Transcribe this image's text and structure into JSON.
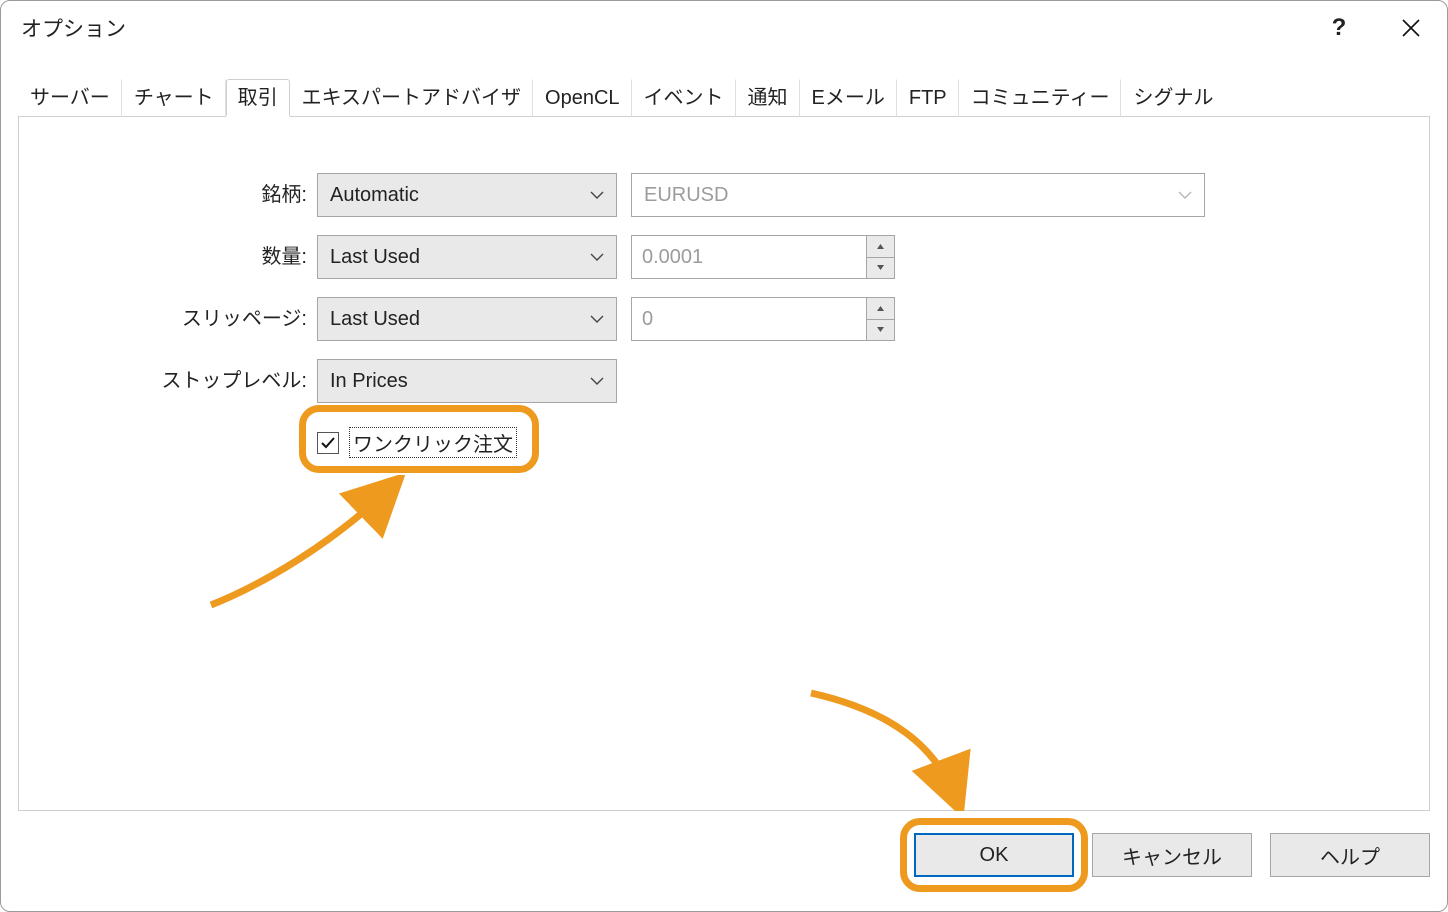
{
  "window": {
    "title": "オプション"
  },
  "tabs": [
    "サーバー",
    "チャート",
    "取引",
    "エキスパートアドバイザ",
    "OpenCL",
    "イベント",
    "通知",
    "Eメール",
    "FTP",
    "コミュニティー",
    "シグナル"
  ],
  "active_tab_index": 2,
  "form": {
    "symbol": {
      "label": "銘柄:",
      "mode": "Automatic",
      "value": "EURUSD"
    },
    "volume": {
      "label": "数量:",
      "mode": "Last Used",
      "value": "0.0001"
    },
    "slippage": {
      "label": "スリッページ:",
      "mode": "Last Used",
      "value": "0"
    },
    "stoplevel": {
      "label": "ストップレベル:",
      "mode": "In Prices"
    },
    "oneclick": {
      "label": "ワンクリック注文",
      "checked": true
    }
  },
  "buttons": {
    "ok": "OK",
    "cancel": "キャンセル",
    "help": "ヘルプ"
  },
  "colors": {
    "highlight": "#ee9a1f",
    "primary": "#0067c0"
  }
}
